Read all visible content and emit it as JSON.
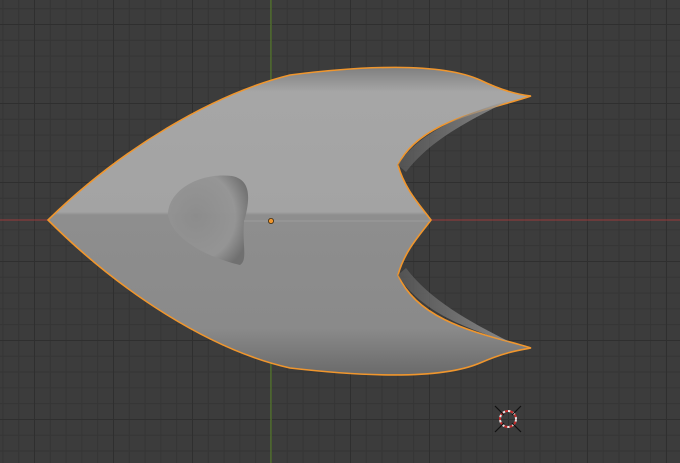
{
  "viewport": {
    "mode": "3d-viewport-top-orthographic",
    "grid": "on",
    "axis_colors": {
      "x": "#9a3a3a",
      "y": "#5f8b2b"
    },
    "selection_outline_color": "#f0962d",
    "object_base_color": "#9a9a9a"
  },
  "object": {
    "selected": true,
    "shape": "arrowhead-mesh"
  },
  "cursor3d": {
    "icon": "3d-cursor-icon"
  },
  "origin": {
    "icon": "object-origin-icon"
  }
}
